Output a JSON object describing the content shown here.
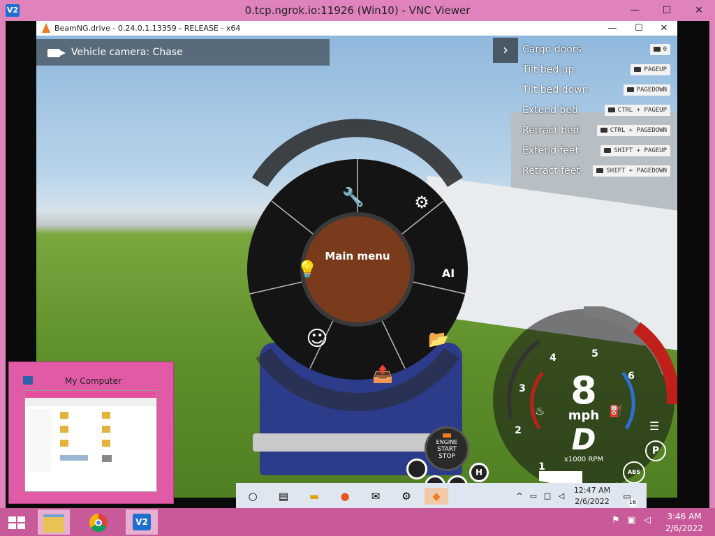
{
  "vnc": {
    "title": "0.tcp.ngrok.io:11926 (Win10) - VNC Viewer",
    "app_icon": "vnc-icon",
    "icon_label": "V2",
    "minimize": "—",
    "maximize": "☐",
    "close": "✕"
  },
  "game_window": {
    "title": "BeamNG.drive - 0.24.0.1.13359 - RELEASE - x64",
    "minimize": "—",
    "maximize": "☐",
    "close": "✕"
  },
  "camera": {
    "label": "Vehicle camera: Chase"
  },
  "hints": [
    {
      "label": "Cargo doors",
      "key": "0"
    },
    {
      "label": "Tilt bed up",
      "key": "PAGEUP"
    },
    {
      "label": "Tilt bed down",
      "key": "PAGEDOWN"
    },
    {
      "label": "Extend bed",
      "key": "CTRL + PAGEUP"
    },
    {
      "label": "Retract bed",
      "key": "CTRL + PAGEDOWN"
    },
    {
      "label": "Extend feet",
      "key": "SHIFT + PAGEUP"
    },
    {
      "label": "Retract feet",
      "key": "SHIFT + PAGEDOWN"
    }
  ],
  "radial_menu": {
    "title": "Main menu",
    "center_color": "#7a3a1c",
    "items": [
      {
        "icon": "wrench-icon",
        "glyph": "🔧"
      },
      {
        "icon": "chassis-icon",
        "glyph": "⚙"
      },
      {
        "icon": "ai-chip-icon",
        "glyph": "AI"
      },
      {
        "icon": "folder-load-icon",
        "glyph": "📂"
      },
      {
        "icon": "folder-save-icon",
        "glyph": "📤"
      },
      {
        "icon": "smiley-icon",
        "glyph": "☺"
      },
      {
        "icon": "lightbulb-icon",
        "glyph": "💡"
      }
    ]
  },
  "gauge": {
    "speed": "8",
    "unit": "mph",
    "gear": "D",
    "rpm_label": "x1000 RPM",
    "rpm_marks": [
      "1",
      "2",
      "3",
      "4",
      "5",
      "6"
    ],
    "redline_color": "#c0201a",
    "indicators": [
      "headlight-icon",
      "parking-brake-icon",
      "abs-icon",
      "turn-left-icon",
      "turn-right-icon",
      "fuel-icon",
      "temperature-icon"
    ],
    "indicator_text": {
      "parking": "P",
      "abs": "ABS"
    }
  },
  "engine": {
    "line1": "ENGINE",
    "line2": "START",
    "line3": "STOP"
  },
  "inner_taskbar": {
    "icons": [
      "cortana-icon",
      "task-view-icon",
      "file-explorer-icon",
      "firefox-icon",
      "mail-icon",
      "settings-icon",
      "beamng-icon"
    ],
    "time": "12:47 AM",
    "date": "2/6/2022",
    "notification_count": "16"
  },
  "thumbnail": {
    "title": "My Computer"
  },
  "host_taskbar": {
    "apps": [
      "file-explorer-icon",
      "chrome-icon",
      "vnc-viewer-icon"
    ],
    "time": "3:46 AM",
    "date": "2/6/2022"
  }
}
